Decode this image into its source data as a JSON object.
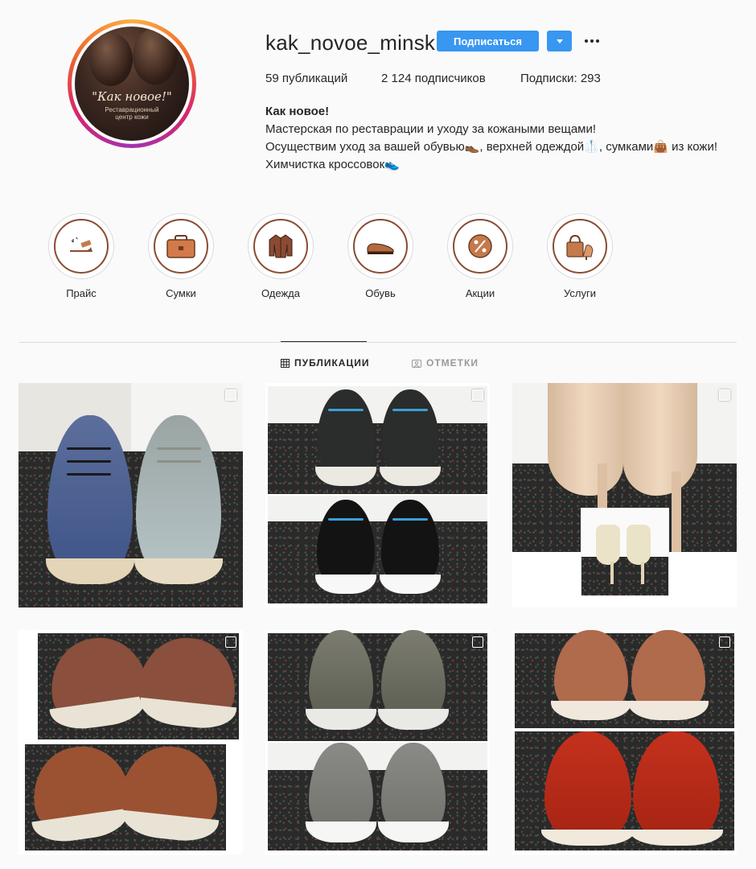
{
  "profile": {
    "username": "kak_novoe_minsk",
    "follow_label": "Подписаться",
    "avatar": {
      "logo_text": "\"Как новое!\"",
      "logo_sub_line1": "Реставрационный",
      "logo_sub_line2": "центр кожи"
    },
    "stats": {
      "posts": {
        "value": "59",
        "label": "публикаций"
      },
      "followers": {
        "value": "2 124",
        "label": "подписчиков"
      },
      "following": {
        "label": "Подписки:",
        "value": "293"
      }
    },
    "bio": {
      "name": "Как новое!",
      "line1": "Мастерская по реставрации и уходу за кожаными вещами!",
      "line2": "Осуществим уход за вашей обувью👞, верхней одеждой🥼, сумками👜 из кожи!",
      "line3": "Химчистка кроссовок👟"
    }
  },
  "highlights": [
    {
      "label": "Прайс",
      "icon": "shoe-shine-icon"
    },
    {
      "label": "Сумки",
      "icon": "briefcase-icon"
    },
    {
      "label": "Одежда",
      "icon": "leather-jacket-icon"
    },
    {
      "label": "Обувь",
      "icon": "shoe-icon"
    },
    {
      "label": "Акции",
      "icon": "percent-badge-icon"
    },
    {
      "label": "Услуги",
      "icon": "bag-and-heel-icon"
    }
  ],
  "tabs": [
    {
      "label": "ПУБЛИКАЦИИ",
      "icon": "grid-icon",
      "active": true
    },
    {
      "label": "ОТМЕТКИ",
      "icon": "tagged-icon",
      "active": false
    }
  ],
  "posts": [
    {
      "subject": "blue leather sneakers before/after",
      "icon": "multi-post-icon"
    },
    {
      "subject": "black suede sneakers before/after",
      "icon": "multi-post-icon"
    },
    {
      "subject": "beige high heels before/after",
      "icon": "multi-post-icon"
    },
    {
      "subject": "brown leather sneakers before/after",
      "icon": "multi-post-icon"
    },
    {
      "subject": "grey suede boots before/after",
      "icon": "multi-post-icon"
    },
    {
      "subject": "red leather shoes before/after",
      "icon": "multi-post-icon"
    }
  ],
  "colors": {
    "accent": "#3897f0",
    "highlight_ring": "#8a4b32",
    "text": "#262626",
    "muted": "#999999",
    "border": "#dbdbdb"
  }
}
